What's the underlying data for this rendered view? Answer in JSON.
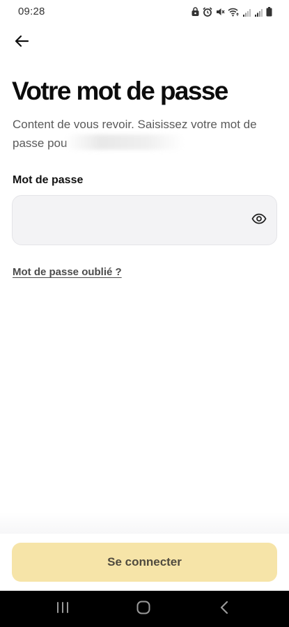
{
  "status_bar": {
    "time": "09:28",
    "icons": [
      "lock-icon",
      "alarm-icon",
      "mute-icon",
      "wifi-icon",
      "signal-icon",
      "signal-icon",
      "battery-icon"
    ]
  },
  "header": {
    "back_icon": "arrow-left-icon"
  },
  "main": {
    "title": "Votre mot de passe",
    "subtitle": "Content de vous revoir. Saisissez votre mot de passe pou",
    "password_label": "Mot de passe",
    "password_value": "",
    "password_placeholder": "",
    "toggle_visibility_icon": "eye-icon",
    "forgot_password": "Mot de passe oublié ?"
  },
  "footer": {
    "connect_label": "Se connecter"
  },
  "nav_bar": {
    "items": [
      "recent-apps-icon",
      "home-icon",
      "back-icon"
    ]
  },
  "colors": {
    "accent_button": "#f6e4a8",
    "field_background": "#f3f3f5",
    "title_text": "#0c0c0c",
    "subtitle_text": "#5a5a5a",
    "nav_background": "#000000"
  }
}
